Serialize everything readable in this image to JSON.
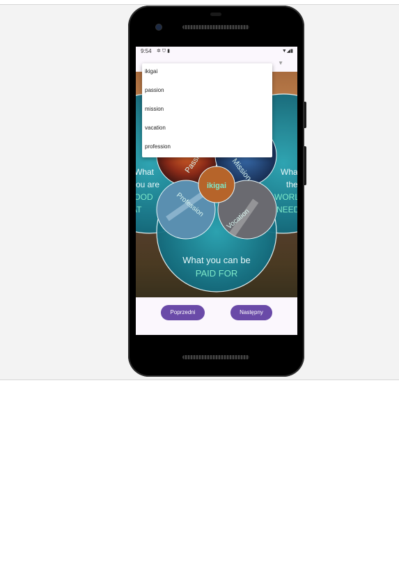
{
  "status_bar": {
    "time": "9:54",
    "left_icons": [
      "gear-icon",
      "shield-icon",
      "sd-card-icon"
    ],
    "right_icons": [
      "wifi-icon",
      "signal-icon",
      "battery-icon"
    ]
  },
  "dropdown": {
    "items": [
      "ikigai",
      "passion",
      "mission",
      "vacation",
      "profession"
    ]
  },
  "diagram": {
    "center": "ikigai",
    "passion": "Passion",
    "mission": "Mission",
    "profession": "Profession",
    "vocation": "Vocation",
    "left_text": [
      "What",
      "you are",
      "GOOD",
      "AT"
    ],
    "right_text": [
      "What",
      "the",
      "WORLD",
      "NEEDS"
    ],
    "bottom_line1": "What you can be",
    "bottom_line2": "PAID FOR"
  },
  "buttons": {
    "prev": "Poprzedni",
    "next": "Następny"
  },
  "colors": {
    "button": "#6a4aa8",
    "accent_text": "#7ee8c8"
  }
}
